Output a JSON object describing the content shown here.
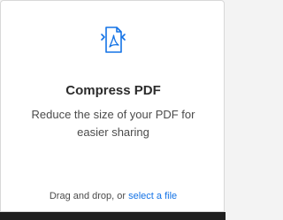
{
  "card": {
    "title": "Compress PDF",
    "description": "Reduce the size of your PDF for easier sharing",
    "drop_prefix": "Drag and drop, or ",
    "select_link": "select a file",
    "icon": "compress-pdf-icon",
    "accent_color": "#1473e6"
  }
}
